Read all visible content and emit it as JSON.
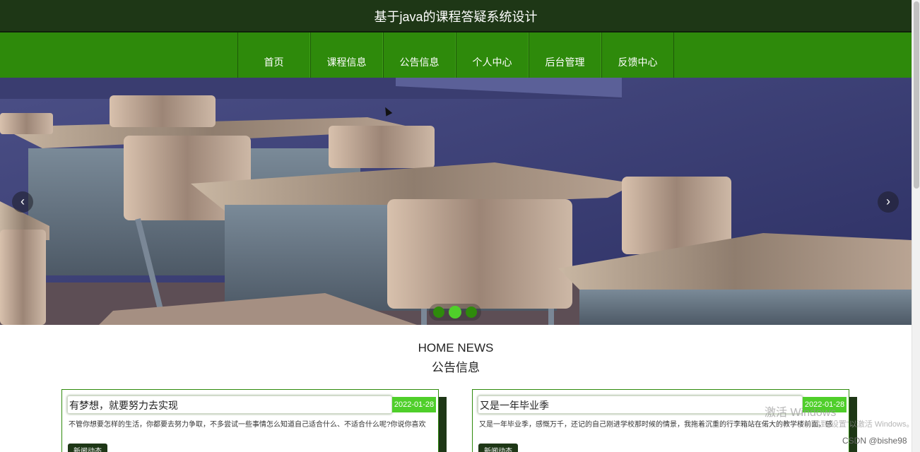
{
  "header": {
    "title": "基于java的课程答疑系统设计"
  },
  "nav": {
    "items": [
      {
        "label": "首页"
      },
      {
        "label": "课程信息"
      },
      {
        "label": "公告信息"
      },
      {
        "label": "个人中心"
      },
      {
        "label": "后台管理"
      },
      {
        "label": "反馈中心"
      }
    ]
  },
  "carousel": {
    "prev_icon": "‹",
    "next_icon": "›",
    "slide_count": 3,
    "active_slide": 2
  },
  "section": {
    "title_en": "HOME NEWS",
    "title_cn": "公告信息"
  },
  "news": [
    {
      "title": "有梦想，就要努力去实现",
      "date": "2022-01-28",
      "summary": "不管你想要怎样的生活，你都要去努力争取，不多尝试一些事情怎么知道自己适合什么、不适合什么呢?你说你喜欢",
      "tag": "新闻动态"
    },
    {
      "title": "又是一年毕业季",
      "date": "2022-01-28",
      "summary": "又是一年毕业季，感慨万千，还记的自己刚进学校那时候的情景，我拖着沉重的行李箱站在偌大的教学楼前面，感",
      "tag": "新闻动态"
    }
  ],
  "overlay": {
    "activation_title": "激活 Windows",
    "activation_sub": "转到\"设置\"以激活 Windows。",
    "csdn": "CSDN @bishe98"
  },
  "colors": {
    "dark_green": "#1e3716",
    "nav_green": "#2e8a0b",
    "accent_green": "#4fcf2a"
  }
}
